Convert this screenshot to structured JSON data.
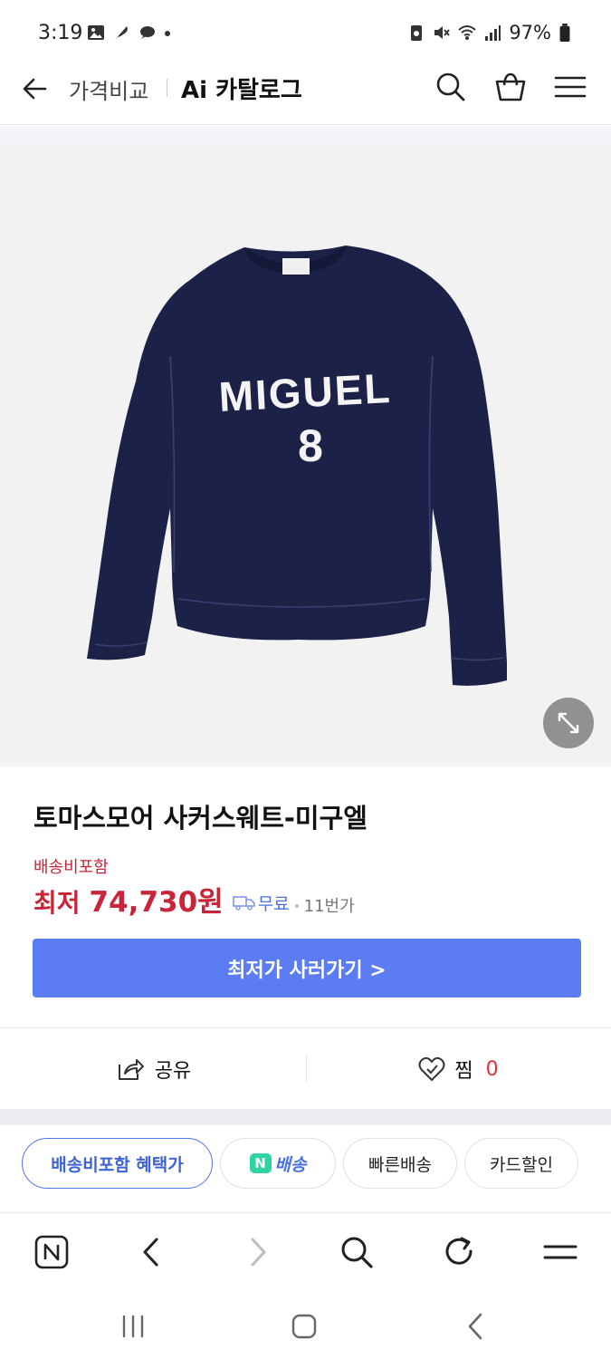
{
  "status_bar": {
    "time": "3:19",
    "battery": "97%",
    "left_icons": [
      "gallery-icon",
      "feather-icon",
      "chat-icon",
      "dot-icon"
    ],
    "right_icons": [
      "battery-saver-icon",
      "mute-icon",
      "wifi-icon",
      "signal-icon",
      "battery-icon"
    ]
  },
  "nav": {
    "back_icon": "back-arrow-icon",
    "compare_label": "가격비교",
    "title": "Ai 카탈로그",
    "icons": [
      "search-icon",
      "cart-icon",
      "menu-icon"
    ]
  },
  "product": {
    "image_text": "MIGUEL",
    "image_number": "8",
    "name": "토마스모어 사커스웨트-미구엘",
    "shipping_note": "배송비포함",
    "price_label": "최저",
    "price": "74,730원",
    "delivery": "무료",
    "mall": "11번가",
    "buy_button": "최저가 사러가기 >"
  },
  "actions": {
    "share": "공유",
    "wish": "찜",
    "wish_count": "0"
  },
  "chips": [
    {
      "label": "배송비포함 혜택가",
      "active": true
    },
    {
      "label": "배송",
      "badge": "N",
      "active": false
    },
    {
      "label": "빠른배송",
      "active": false
    },
    {
      "label": "카드할인",
      "active": false
    }
  ],
  "browser_toolbar": [
    "naver-n-icon",
    "back-chevron-icon",
    "forward-chevron-icon",
    "search-icon",
    "reload-icon",
    "menu-icon"
  ],
  "system_nav": [
    "recent-apps-icon",
    "home-icon",
    "back-icon"
  ],
  "colors": {
    "price_red": "#c8243a",
    "accent_blue": "#5b7cf2",
    "sweater_navy": "#1b2147"
  }
}
